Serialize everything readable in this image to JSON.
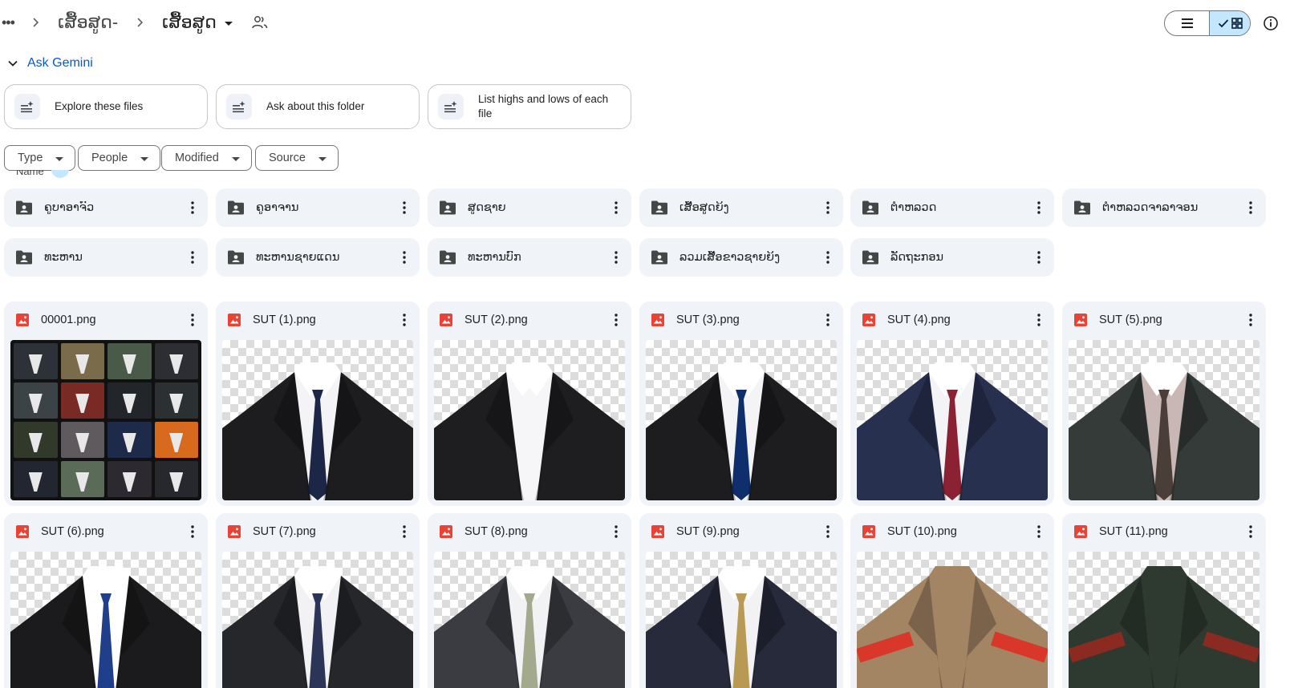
{
  "breadcrumb": {
    "more": "•••",
    "parent": "ເສື້ອສູດ-",
    "current": "ເສື້ອສູດ"
  },
  "gemini": {
    "label": "Ask Gemini",
    "suggestions": [
      "Explore these files",
      "Ask about this folder",
      "List highs and lows of each file"
    ]
  },
  "filters": [
    "Type",
    "People",
    "Modified",
    "Source"
  ],
  "list_header": {
    "name_label": "Name"
  },
  "folders": [
    "ຄູບາອາຈົວ",
    "ຄູອາຈານ",
    "ສູດຊາຍ",
    "ເສື້ອສູດຍິງ",
    "ຕໍາຫລວດ",
    "ຕໍາຫລວດຈາລາຈອນ",
    "ທະຫານ",
    "ທະຫານຊາຍແດນ",
    "ທະຫານບົກ",
    "ລວມເສື້ອຂາວຊາຍຍິງ",
    "ລັດຖະກອນ"
  ],
  "files": [
    "00001.png",
    "SUT (1).png",
    "SUT (2).png",
    "SUT (3).png",
    "SUT (4).png",
    "SUT (5).png",
    "SUT (6).png",
    "SUT (7).png",
    "SUT (8).png",
    "SUT (9).png",
    "SUT (10).png",
    "SUT (11).png"
  ],
  "colors": {
    "accent": "#0b57d0",
    "selected_toggle": "#c2e7ff",
    "card_bg": "#f0f4f9",
    "image_icon": "#ea4335"
  },
  "icons": {
    "more": "more-horizontal-icon",
    "separator": "chevron-right-icon",
    "share": "people-icon",
    "list_view": "list-icon",
    "grid_view": "grid-icon",
    "info": "info-icon",
    "suggestion": "sparkle-list-icon",
    "folder": "shared-folder-icon",
    "file": "image-file-icon"
  }
}
